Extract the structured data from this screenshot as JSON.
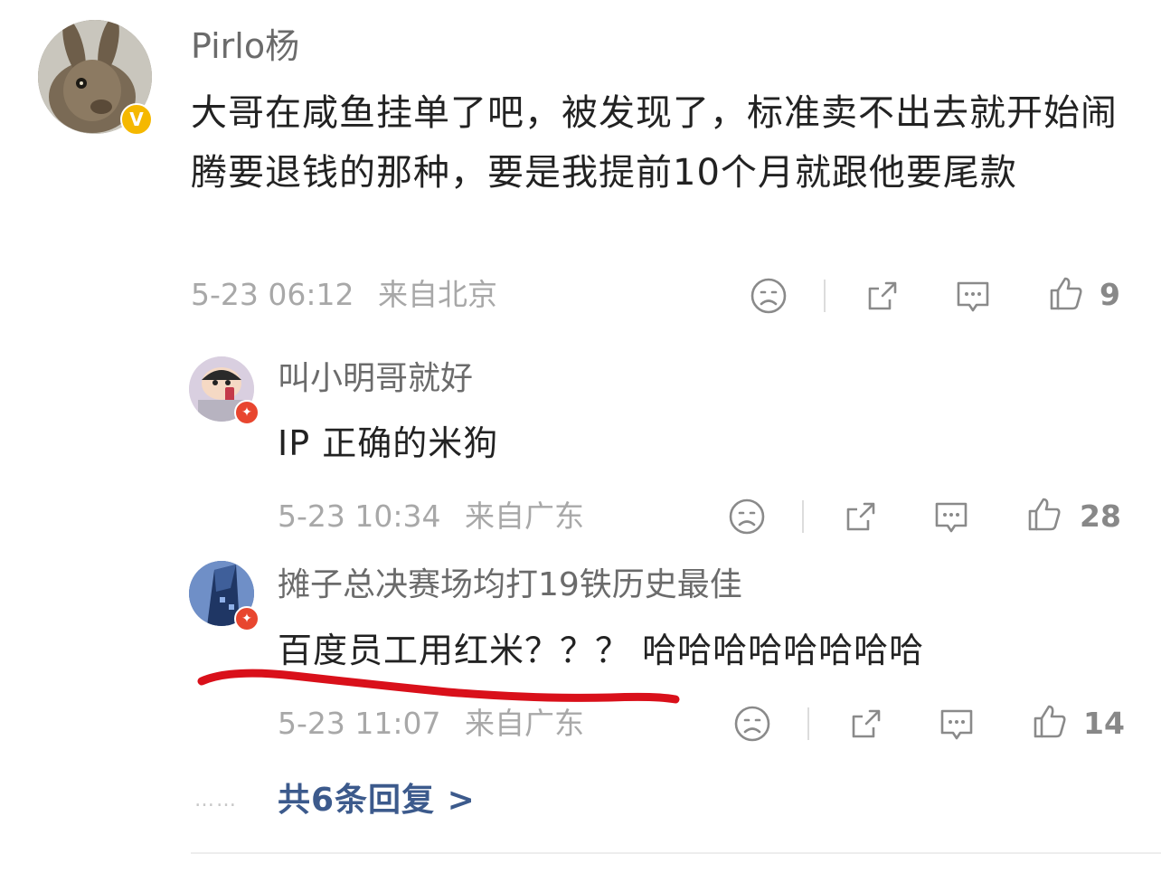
{
  "comment": {
    "author": "Pirlo杨",
    "verified_badge": "V",
    "text": "大哥在咸鱼挂单了吧，被发现了，标准卖不出去就开始闹腾要退钱的那种，要是我提前10个月就跟他要尾款",
    "date": "5-23 06:12",
    "location": "来自北京",
    "likes": "9"
  },
  "replies": [
    {
      "author": "叫小明哥就好",
      "text": "IP 正确的米狗",
      "date": "5-23 10:34",
      "location": "来自广东",
      "likes": "28"
    },
    {
      "author": "摊子总决赛场均打19铁历史最佳",
      "text": "百度员工用红米？？？ 哈哈哈哈哈哈哈哈",
      "date": "5-23 11:07",
      "location": "来自广东",
      "likes": "14"
    }
  ],
  "more_replies": {
    "dots": "……",
    "label": "共6条回复 >"
  },
  "colors": {
    "accent": "#3c5a8c",
    "annotation": "#d9101a",
    "verified": "#f5b800",
    "member_badge": "#e8462f"
  },
  "icons": [
    "sad-face-icon",
    "share-icon",
    "comment-icon",
    "thumbs-up-icon",
    "verified-badge-icon",
    "member-badge-icon"
  ]
}
